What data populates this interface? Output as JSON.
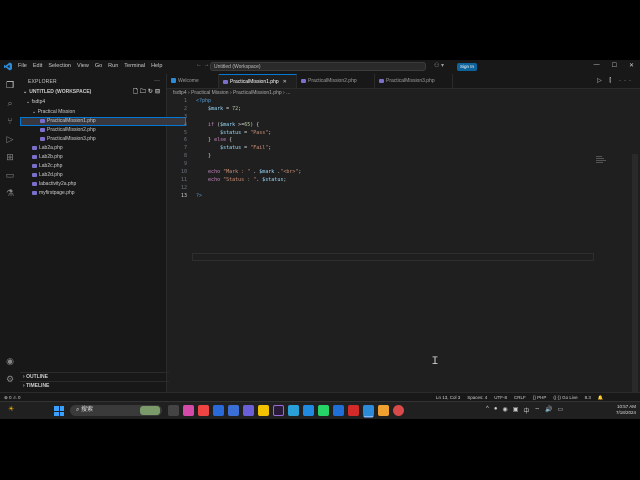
{
  "titlebar": {
    "menu": [
      "File",
      "Edit",
      "Selection",
      "View",
      "Go",
      "Run",
      "Terminal",
      "Help"
    ],
    "search_text": "Untitled (Workspace)",
    "sign_in": "Sign In"
  },
  "sidebar": {
    "title": "EXPLORER",
    "workspace": "UNTITLED (WORKSPACE)",
    "root_folder": "fsdtp4",
    "subfolder": "Practical Mission",
    "files_in_subfolder": [
      "PracticalMission1.php",
      "PracticalMission2.php",
      "PracticalMission3.php"
    ],
    "files_root": [
      "Lab2a.php",
      "Lab2b.php",
      "Lab2c.php",
      "Lab2d.php",
      "labactivity2a.php",
      "myfirstpage.php"
    ],
    "outline": "OUTLINE",
    "timeline": "TIMELINE"
  },
  "tabs": [
    {
      "label": "Welcome"
    },
    {
      "label": "PracticalMission1.php"
    },
    {
      "label": "PracticalMission2.php"
    },
    {
      "label": "PracticalMission3.php"
    }
  ],
  "breadcrumb": "fsdtp4 › Practical Mission › PracticalMission1.php › ...",
  "code_lines": [
    "<?php",
    "    $mark = 72;",
    "",
    "    if ($mark >=65) {",
    "        $status = \"Pass\";",
    "    } else {",
    "        $status = \"Fail\";",
    "    }",
    "",
    "    echo \"Mark : \" . $mark .\"<br>\";",
    "    echo \"Status : \". $status;",
    "",
    "?>"
  ],
  "active_line": 13,
  "statusbar": {
    "left_icons": "⊗ 0 ⚠ 0",
    "position": "Ln 13, Col 3",
    "spaces": "Spaces: 4",
    "encoding": "UTF-8",
    "eol": "CRLF",
    "language": "PHP",
    "golive": "Go Live",
    "version": "8.3"
  },
  "taskbar": {
    "search_text": "搜索",
    "time": "10:57 AM",
    "date": "7/18/2024"
  },
  "colors": {
    "accent": "#0078d4",
    "editor_bg": "#1f1f1f",
    "sidebar_bg": "#181818",
    "keyword": "#c586c0",
    "variable": "#9cdcfe",
    "string": "#ce9178"
  }
}
